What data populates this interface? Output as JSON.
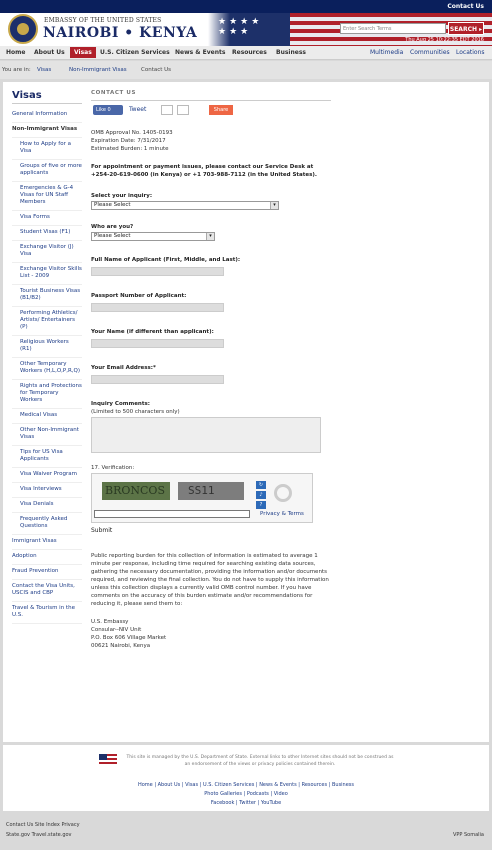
{
  "topbar": {
    "contact_us": "Contact Us"
  },
  "header": {
    "embassy_line": "EMBASSY OF THE UNITED STATES",
    "city": "NAIROBI • KENYA",
    "search_placeholder": "Enter Search Terms",
    "search_button": "SEARCH ▸",
    "datetime": "Thu Aug 25 10:22:35 EDT 2016"
  },
  "nav": {
    "items": [
      "Home",
      "About Us",
      "Visas",
      "U.S. Citizen Services",
      "News & Events",
      "Resources",
      "Business"
    ],
    "right_items": [
      "Multimedia",
      "Communities",
      "Locations"
    ]
  },
  "breadcrumb": {
    "prefix": "You are in:",
    "items": [
      "Visas",
      "Non-Immigrant Visas",
      "Contact Us"
    ]
  },
  "sidebar": {
    "title": "Visas",
    "items": [
      {
        "label": "General Information",
        "level": 0
      },
      {
        "label": "Non-Immigrant Visas",
        "level": 0,
        "bold": true
      },
      {
        "label": "How to Apply for a Visa",
        "level": 1
      },
      {
        "label": "Groups of five or more applicants",
        "level": 1
      },
      {
        "label": "Emergencies & G-4 Visas for UN Staff Members",
        "level": 1
      },
      {
        "label": "Visa Forms",
        "level": 1
      },
      {
        "label": "Student Visas (F1)",
        "level": 1
      },
      {
        "label": "Exchange Visitor (J) Visa",
        "level": 1
      },
      {
        "label": "Exchange Visitor Skills List - 2009",
        "level": 1
      },
      {
        "label": "Tourist Business Visas (B1/B2)",
        "level": 1
      },
      {
        "label": "Performing Athletics/ Artists/ Entertainers (P)",
        "level": 1
      },
      {
        "label": "Religious Workers (R1)",
        "level": 1
      },
      {
        "label": "Other Temporary Workers (H,L,O,P,R,Q)",
        "level": 1
      },
      {
        "label": "Rights and Protections for Temporary Workers",
        "level": 1
      },
      {
        "label": "Medical Visas",
        "level": 1
      },
      {
        "label": "Other Non-Immigrant Visas",
        "level": 1
      },
      {
        "label": "Tips for US Visa Applicants",
        "level": 1
      },
      {
        "label": "Visa Waiver Program",
        "level": 1
      },
      {
        "label": "Visa Interviews",
        "level": 1
      },
      {
        "label": "Visa Denials",
        "level": 1
      },
      {
        "label": "Frequently Asked Questions",
        "level": 1
      },
      {
        "label": "Immigrant Visas",
        "level": 0
      },
      {
        "label": "Adoption",
        "level": 0
      },
      {
        "label": "Fraud Prevention",
        "level": 0
      },
      {
        "label": "Contact the Visa Units, USCIS and CBP",
        "level": 0
      },
      {
        "label": "Travel & Tourism in the U.S.",
        "level": 0
      }
    ]
  },
  "content": {
    "title": "CONTACT US",
    "social": {
      "like": "Like 0",
      "tweet": "Tweet",
      "share": "Share"
    },
    "omb": [
      "OMB Approval No. 1405-0193",
      "Expiration Date: 7/31/2017",
      "Estimated Burden: 1 minute"
    ],
    "notice": "For appointment or payment issues, please contact our Service Desk at +254-20-619-0600 (in Kenya) or +1 703-988-7112 (in the United States).",
    "inquiry_label": "Select your inquiry:",
    "inquiry_value": "Please Select",
    "who_label": "Who are you?",
    "who_value": "Please Select",
    "applicant_name_label": "Full Name of Applicant (First, Middle, and Last):",
    "passport_label": "Passport Number of Applicant:",
    "your_name_label": "Your Name (if different than applicant):",
    "email_label": "Your Email Address:*",
    "comments_label": "Inquiry Comments:",
    "comments_sublabel": "(Limited to 500 characters only)",
    "verification_label": "17. Verification:",
    "captcha_word1": "BRONCOS",
    "captcha_word2": "SS11",
    "privacy_terms": "Privacy & Terms",
    "submit": "Submit",
    "burden": "Public reporting burden for this collection of information is estimated to average 1 minute per response, including time required for searching existing data sources, gathering the necessary documentation, providing the information and/or documents required, and reviewing the final collection. You do not have to supply this information unless this collection displays a currently valid OMB control number. If you have comments on the accuracy of this burden estimate and/or recommendations for reducing it, please send them to:",
    "address": [
      "U.S. Embassy",
      "Consular--NIV Unit",
      "P.O. Box 606 Village Market",
      "00621 Nairobi, Kenya"
    ]
  },
  "footer": {
    "disclaimer": "This site is managed by the U.S. Department of State. External links to other Internet sites should not be construed as an endorsement of the views or privacy policies contained therein.",
    "links_row1": "Home | About Us | Visas | U.S. Citizen Services | News & Events | Resources | Business",
    "links_row2": "Photo Galleries | Podcasts | Video",
    "links_row3": "Facebook | Twitter | YouTube"
  },
  "bottom": {
    "row1": "Contact Us   Site Index   Privacy",
    "row2": "State.gov   Travel.state.gov",
    "right": "VPP Somalia"
  }
}
